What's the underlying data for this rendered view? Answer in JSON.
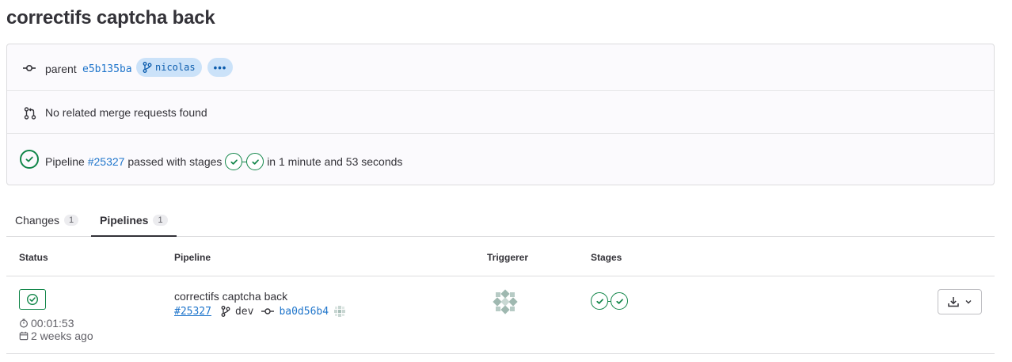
{
  "page": {
    "title": "correctifs captcha back"
  },
  "commit_info": {
    "parent_label": "parent",
    "parent_sha": "e5b135ba",
    "branch": "nicolas",
    "more_label": "•••",
    "merge_requests_text": "No related merge requests found",
    "pipeline_prefix": "Pipeline",
    "pipeline_id": "#25327",
    "pipeline_middle": "passed with stages",
    "pipeline_suffix": "in 1 minute and 53 seconds",
    "colors": {
      "success": "#108548",
      "link": "#1f75cb",
      "pill_bg": "#cbe2f9"
    }
  },
  "tabs": [
    {
      "label": "Changes",
      "count": "1",
      "active": false
    },
    {
      "label": "Pipelines",
      "count": "1",
      "active": true
    }
  ],
  "table": {
    "headers": {
      "status": "Status",
      "pipeline": "Pipeline",
      "triggerer": "Triggerer",
      "stages": "Stages"
    },
    "rows": [
      {
        "status_icon": "status-success-icon",
        "duration": "00:01:53",
        "finished": "2 weeks ago",
        "title": "correctifs captcha back",
        "pipeline_id": "#25327",
        "ref": "dev",
        "sha": "ba0d56b4",
        "stages": [
          "passed",
          "passed"
        ]
      }
    ]
  }
}
